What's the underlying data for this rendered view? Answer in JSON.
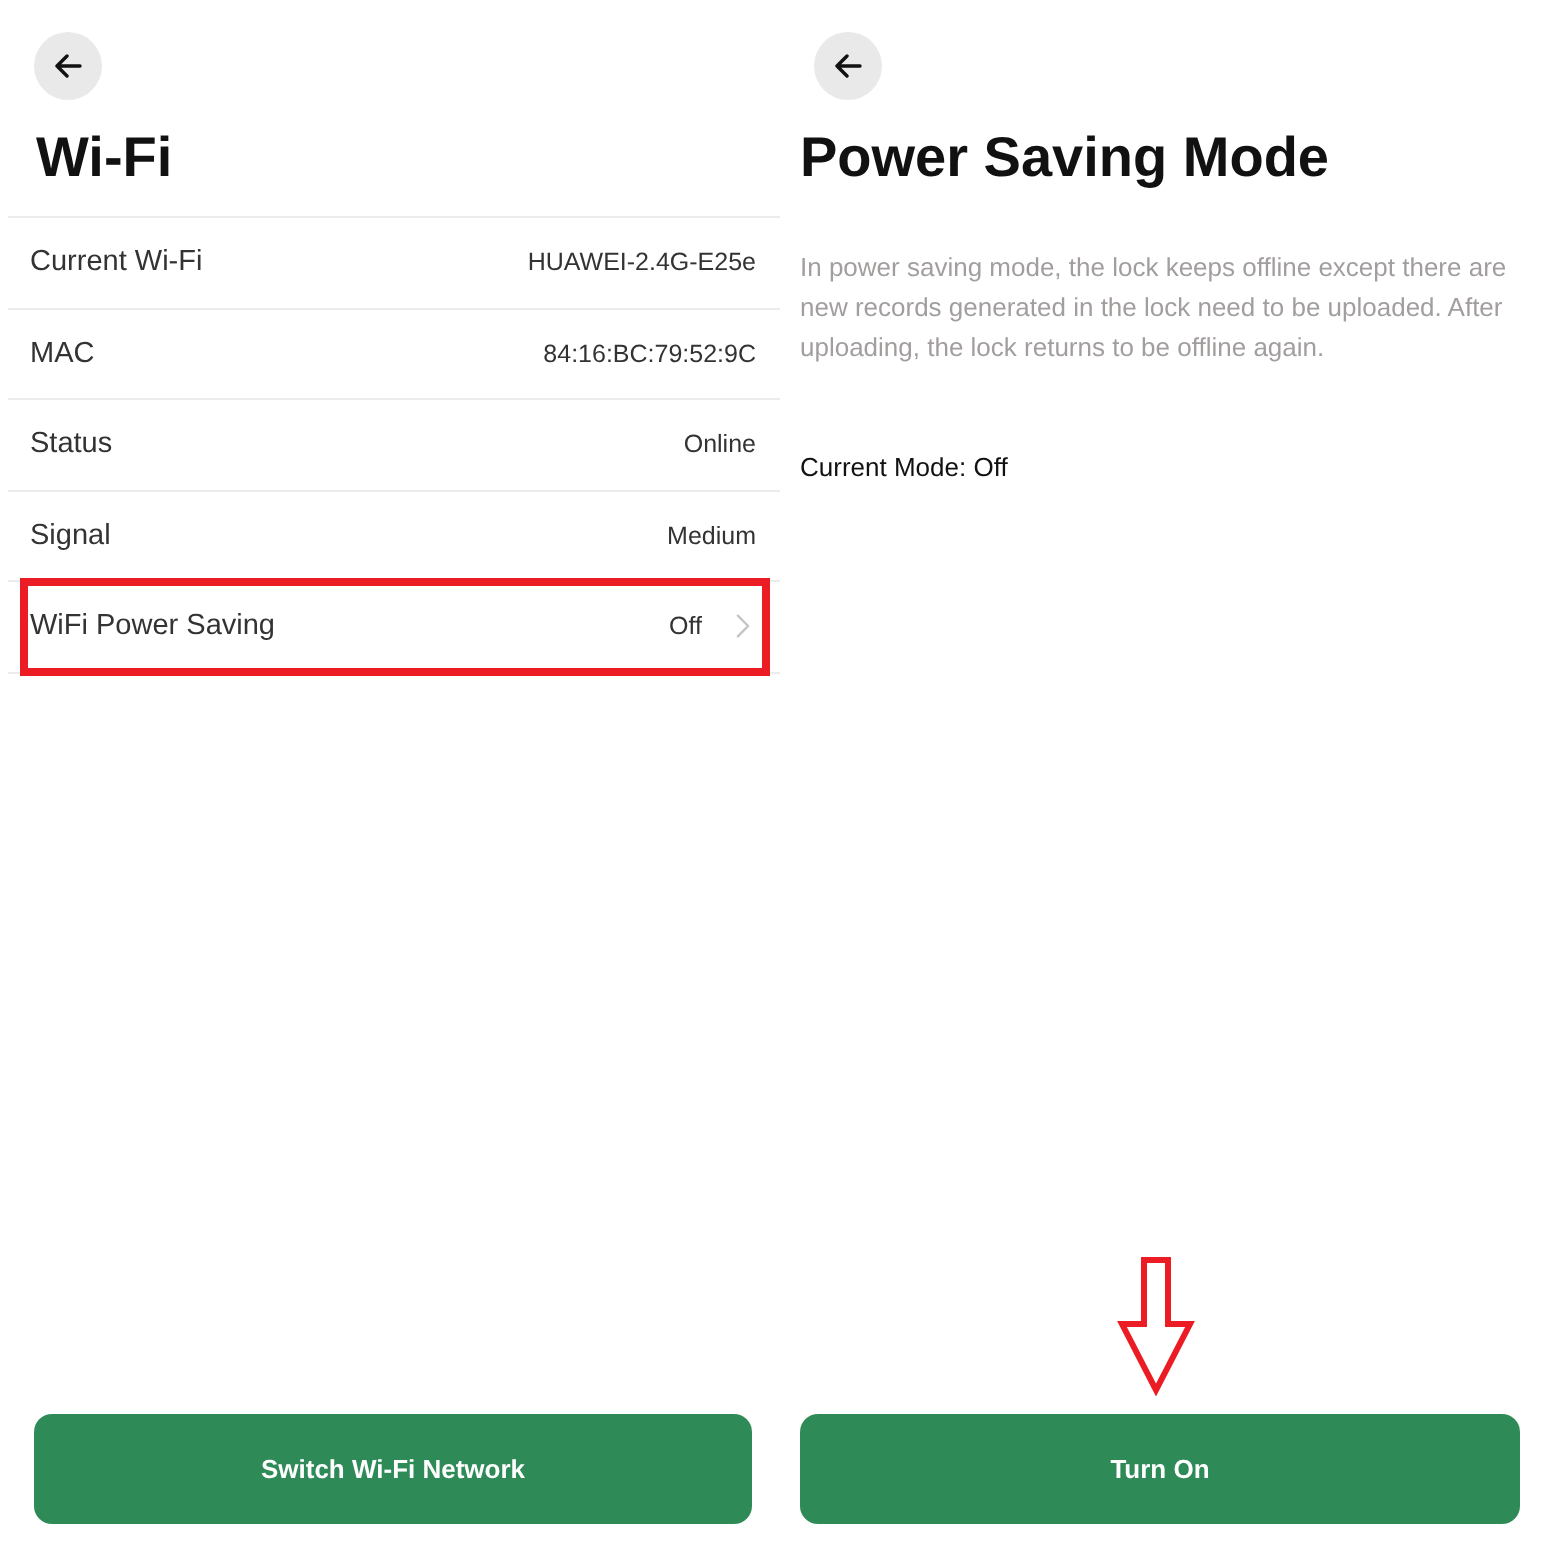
{
  "wifi_screen": {
    "title": "Wi-Fi",
    "rows": [
      {
        "kind": "info",
        "label": "Current Wi-Fi",
        "value": "HUAWEI-2.4G-E25e",
        "highlighted": false
      },
      {
        "kind": "info",
        "label": "MAC",
        "value": "84:16:BC:79:52:9C",
        "highlighted": false
      },
      {
        "kind": "info",
        "label": "Status",
        "value": "Online",
        "highlighted": false
      },
      {
        "kind": "info",
        "label": "Signal",
        "value": "Medium",
        "highlighted": false
      },
      {
        "kind": "link",
        "label": "WiFi Power Saving",
        "value": "Off",
        "highlighted": true
      }
    ],
    "button": {
      "label": "Switch Wi-Fi Network",
      "arrow_marked": false
    }
  },
  "power_saving_screen": {
    "title": "Power Saving Mode",
    "description": "In power saving mode, the lock keeps offline except there are new records generated in the lock need to be uploaded. After uploading, the lock returns to be offline again.",
    "current_mode": "Current Mode: Off",
    "button": {
      "label": "Turn On",
      "arrow_marked": true
    }
  }
}
